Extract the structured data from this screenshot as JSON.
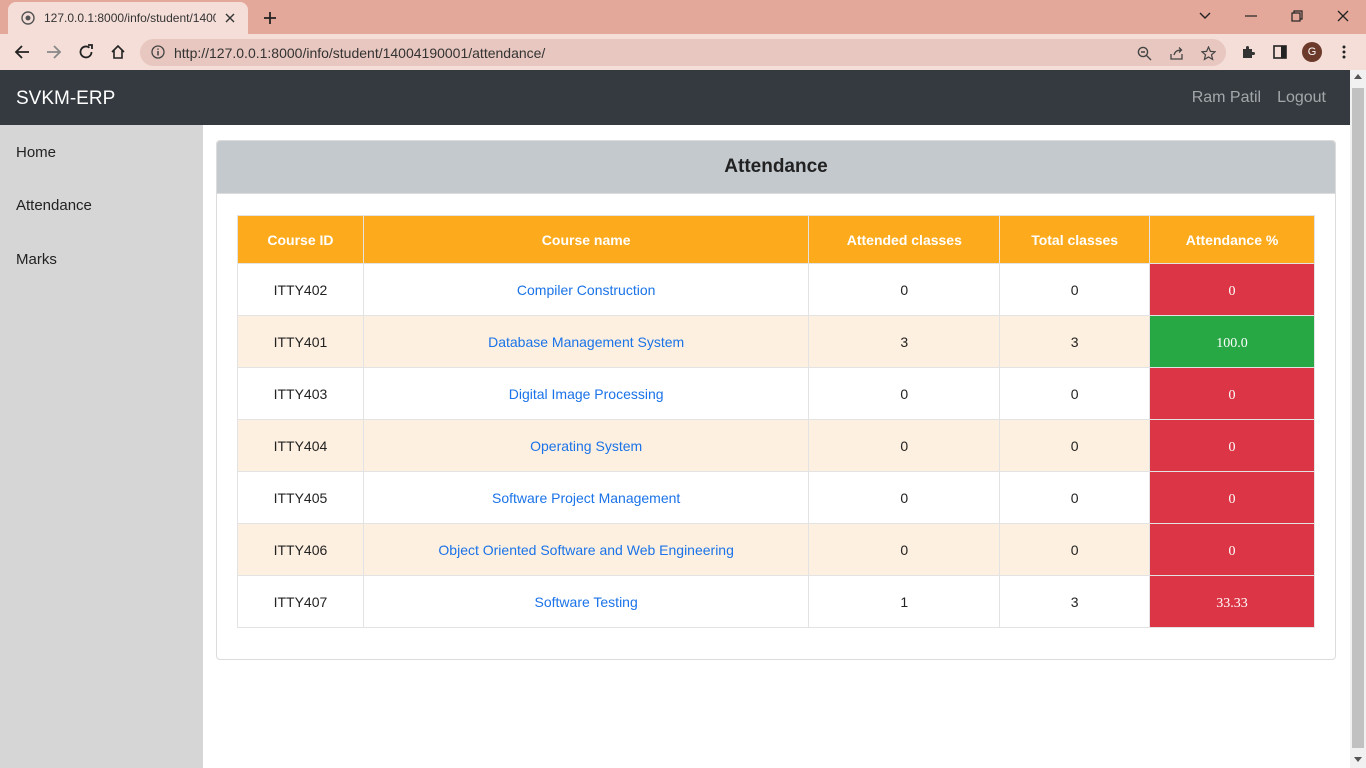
{
  "browser": {
    "tab_title": "127.0.0.1:8000/info/student/1400",
    "url": "http://127.0.0.1:8000/info/student/14004190001/attendance/",
    "profile_initial": "G"
  },
  "navbar": {
    "brand": "SVKM-ERP",
    "user_name": "Ram Patil",
    "logout": "Logout"
  },
  "sidebar": {
    "items": [
      {
        "label": "Home"
      },
      {
        "label": "Attendance"
      },
      {
        "label": "Marks"
      }
    ]
  },
  "card": {
    "title": "Attendance"
  },
  "table": {
    "headers": [
      "Course ID",
      "Course name",
      "Attended classes",
      "Total classes",
      "Attendance %"
    ],
    "rows": [
      {
        "id": "ITTY402",
        "name": "Compiler Construction",
        "attended": "0",
        "total": "0",
        "pct": "0",
        "status": "low"
      },
      {
        "id": "ITTY401",
        "name": "Database Management System",
        "attended": "3",
        "total": "3",
        "pct": "100.0",
        "status": "good"
      },
      {
        "id": "ITTY403",
        "name": "Digital Image Processing",
        "attended": "0",
        "total": "0",
        "pct": "0",
        "status": "low"
      },
      {
        "id": "ITTY404",
        "name": "Operating System",
        "attended": "0",
        "total": "0",
        "pct": "0",
        "status": "low"
      },
      {
        "id": "ITTY405",
        "name": "Software Project Management",
        "attended": "0",
        "total": "0",
        "pct": "0",
        "status": "low"
      },
      {
        "id": "ITTY406",
        "name": "Object Oriented Software and Web Engineering",
        "attended": "0",
        "total": "0",
        "pct": "0",
        "status": "low"
      },
      {
        "id": "ITTY407",
        "name": "Software Testing",
        "attended": "1",
        "total": "3",
        "pct": "33.33",
        "status": "low"
      }
    ]
  },
  "colors": {
    "header_orange": "#fdab1c",
    "low": "#dc3545",
    "good": "#28a745",
    "link": "#1a73e8",
    "navbar": "#343a40"
  }
}
